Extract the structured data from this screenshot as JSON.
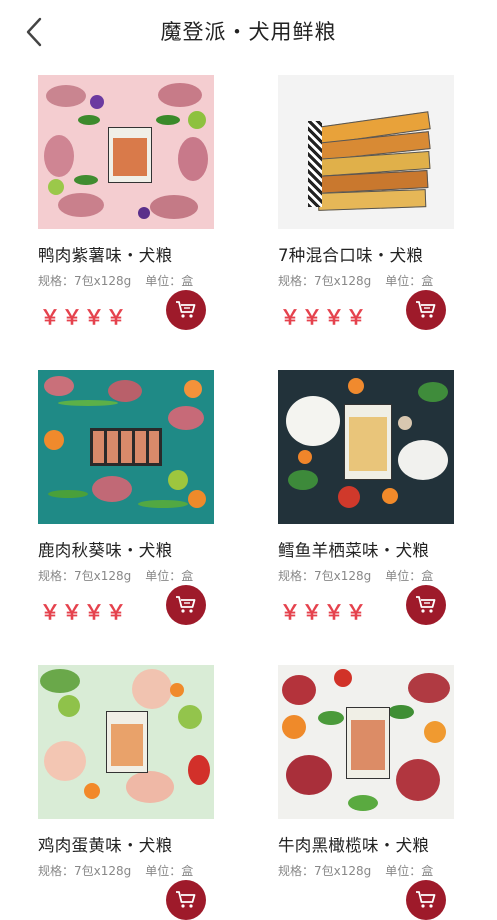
{
  "header": {
    "title": "魔登派・犬用鲜粮"
  },
  "products": [
    {
      "name": "鸭肉紫薯味・犬粮",
      "spec_label": "规格：7包x128g",
      "unit_label": "单位：盒",
      "price": "￥￥￥￥"
    },
    {
      "name": "7种混合口味・犬粮",
      "spec_label": "规格：7包x128g",
      "unit_label": "单位：盒",
      "price": "￥￥￥￥"
    },
    {
      "name": "鹿肉秋葵味・犬粮",
      "spec_label": "规格：7包x128g",
      "unit_label": "单位：盒",
      "price": "￥￥￥￥"
    },
    {
      "name": "鳕鱼羊栖菜味・犬粮",
      "spec_label": "规格：7包x128g",
      "unit_label": "单位：盒",
      "price": "￥￥￥￥"
    },
    {
      "name": "鸡肉蛋黄味・犬粮",
      "spec_label": "规格：7包x128g",
      "unit_label": "单位：盒",
      "price": ""
    },
    {
      "name": "牛肉黑橄榄味・犬粮",
      "spec_label": "规格：7包x128g",
      "unit_label": "单位：盒",
      "price": ""
    }
  ],
  "colors": {
    "accent": "#9e1a2a",
    "price": "#e5424d"
  }
}
